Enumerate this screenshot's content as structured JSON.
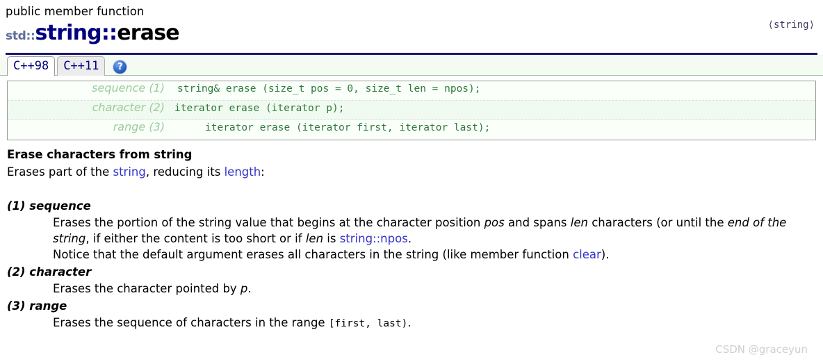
{
  "header": {
    "kind": "public member function",
    "title_std": "std::",
    "title_class": "string",
    "title_separator": "::",
    "title_function": "erase",
    "include": "⟨string⟩"
  },
  "tabs": {
    "items": [
      {
        "label": "C++98",
        "active": true
      },
      {
        "label": "C++11",
        "active": false
      }
    ],
    "help_icon": "?",
    "help_icon_name": "question-mark-icon"
  },
  "signatures": [
    {
      "label": "sequence (1)",
      "code": "string& erase (size_t pos = 0, size_t len = npos);"
    },
    {
      "label": "character (2)",
      "code": "iterator erase (iterator p);"
    },
    {
      "label": "range (3)",
      "code": "iterator erase (iterator first, iterator last);"
    }
  ],
  "description": {
    "title": "Erase characters from string",
    "lead_before_link1": "Erases part of the ",
    "lead_link1": "string",
    "lead_between": ", reducing its ",
    "lead_link2": "length",
    "lead_after": ":"
  },
  "variants": [
    {
      "head": "(1) sequence",
      "p1_a": "Erases the portion of the string value that begins at the character position ",
      "p1_i1": "pos",
      "p1_b": " and spans ",
      "p1_i2": "len",
      "p1_c": " characters (or until the ",
      "p1_i3": "end of the string",
      "p1_d": ", if either the content is too short or if ",
      "p1_i4": "len",
      "p1_e": " is ",
      "p1_link": "string::npos",
      "p1_f": ".",
      "p2_a": "Notice that the default argument erases all characters in the string (like member function ",
      "p2_link": "clear",
      "p2_b": ")."
    },
    {
      "head": "(2) character",
      "p1_a": "Erases the character pointed by ",
      "p1_i1": "p",
      "p1_b": "."
    },
    {
      "head": "(3) range",
      "p1_a": "Erases the sequence of characters in the range ",
      "p1_mono": "[first, last)",
      "p1_b": "."
    }
  ],
  "watermark": "CSDN @graceyun",
  "colors": {
    "title_navy": "#000080",
    "rule_navy": "#1a1a6e",
    "link_blue": "#3333cc",
    "sig_code_green": "#2f7a3a",
    "sig_label_green": "#9ccb9c",
    "tabstrip_bg": "#f3fbf3",
    "watermark_gray": "#cfcfcf"
  }
}
